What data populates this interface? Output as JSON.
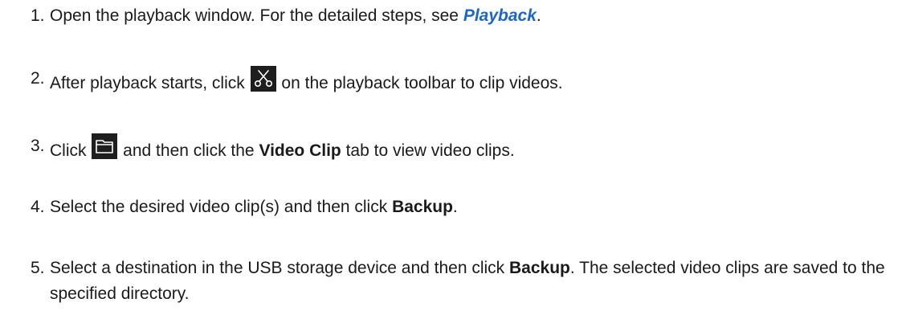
{
  "steps": [
    {
      "number": "1.",
      "text_before": "Open the playback window. For the detailed steps, see ",
      "link": "Playback",
      "text_after": "."
    },
    {
      "number": "2.",
      "text_before": "After playback starts, click ",
      "icon": "scissors-icon",
      "text_after": " on the playback toolbar to clip videos."
    },
    {
      "number": "3.",
      "text_before": "Click ",
      "icon": "folder-icon",
      "text_middle": " and then click the ",
      "bold": "Video Clip",
      "text_after": " tab to view video clips."
    },
    {
      "number": "4.",
      "text_before": "Select the desired video clip(s) and then click ",
      "bold": "Backup",
      "text_after": "."
    },
    {
      "number": "5.",
      "text_before": "Select a destination in the USB storage device and then click ",
      "bold": "Backup",
      "text_after": ". The selected video clips are saved to the specified directory."
    }
  ],
  "colors": {
    "text": "#1a1a1a",
    "link": "#1b66c9",
    "icon_background": "#1e1e1e",
    "icon_glyph": "#ffffff"
  }
}
